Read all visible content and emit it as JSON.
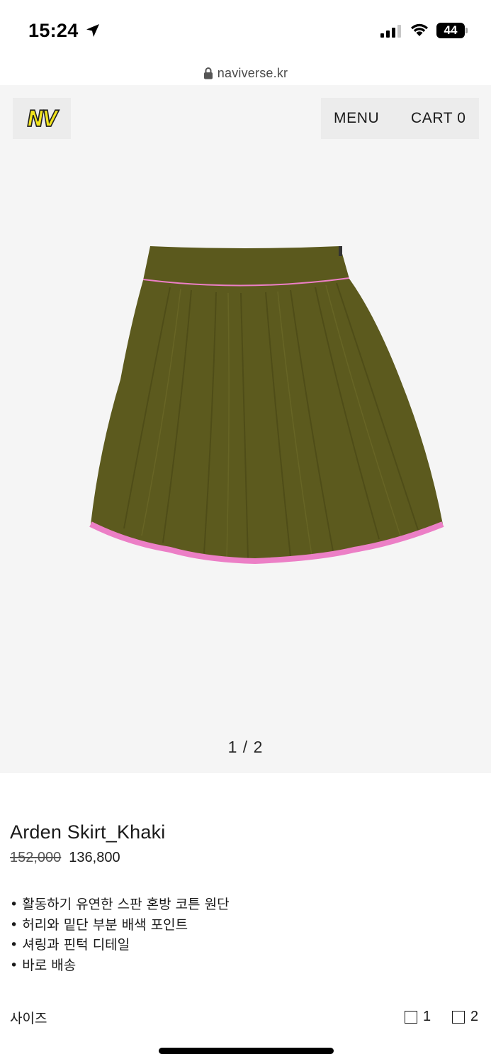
{
  "status_bar": {
    "time": "15:24",
    "battery": "44",
    "icons": [
      "location-arrow-icon",
      "cellular-signal-icon",
      "wifi-icon",
      "battery-icon"
    ]
  },
  "browser": {
    "url": "naviverse.kr",
    "lock_icon": "lock-icon"
  },
  "header": {
    "logo": "NV",
    "menu_label": "MENU",
    "cart_label": "CART 0"
  },
  "gallery": {
    "pager": "1 / 2",
    "current_index": 1,
    "total": 2
  },
  "product": {
    "name": "Arden Skirt_Khaki",
    "original_price": "152,000",
    "sale_price": "136,800",
    "description": [
      "활동하기 유연한 스판 혼방 코튼 원단",
      "허리와 밑단 부분 배색 포인트",
      "셔링과 핀턱 디테일",
      "바로 배송"
    ],
    "size_label": "사이즈",
    "sizes": [
      "1",
      "2"
    ]
  },
  "colors": {
    "skirt": "#5c5a1e",
    "piping": "#ec7fc6",
    "logo_yellow": "#f2e41c",
    "gallery_bg": "#f5f5f5"
  }
}
